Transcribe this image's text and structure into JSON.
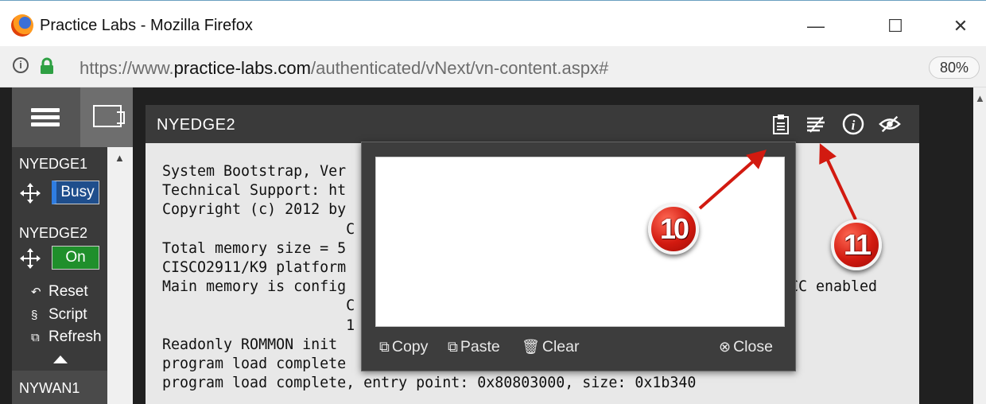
{
  "window": {
    "title": "Practice Labs - Mozilla Firefox",
    "minimize_glyph": "—",
    "maximize_glyph": "☐",
    "close_glyph": "✕"
  },
  "urlbar": {
    "url_prefix": "https://www.",
    "url_domain": "practice-labs.com",
    "url_path": "/authenticated/vNext/vn-content.aspx#",
    "zoom": "80%"
  },
  "sidebar": {
    "devices": [
      {
        "name": "NYEDGE1",
        "state": "Busy"
      },
      {
        "name": "NYEDGE2",
        "state": "On"
      }
    ],
    "actions": [
      {
        "icon": "reset-icon",
        "label": "Reset"
      },
      {
        "icon": "script-icon",
        "label": "Script"
      },
      {
        "icon": "refresh-icon",
        "label": "Refresh"
      }
    ],
    "next_device": "NYWAN1"
  },
  "terminal": {
    "title": "NYEDGE2",
    "lines": [
      "System Bootstrap, Ver",
      "Technical Support: ht",
      "Copyright (c) 2012 by",
      "                     C",
      "Total memory size = 5",
      "CISCO2911/K9 platform",
      "Main memory is config",
      "                     C",
      "                     1",
      "Readonly ROMMON init",
      "program load complete",
      "program load complete, entry point: 0x80803000, size: 0x1b340"
    ],
    "ecc_fragment": "CC enabled",
    "header_icons": [
      "clipboard-icon",
      "text-mode-icon",
      "info-icon",
      "hide-icon"
    ]
  },
  "clipboard": {
    "value": "",
    "copy_label": "Copy",
    "paste_label": "Paste",
    "clear_label": "Clear",
    "close_label": "Close"
  },
  "callouts": [
    "10",
    "11"
  ],
  "colors": {
    "callout_red": "#d21a10",
    "status_on": "#1f8f2b",
    "status_busy": "#1f4e8c",
    "terminal_header": "#3a3a3a"
  }
}
